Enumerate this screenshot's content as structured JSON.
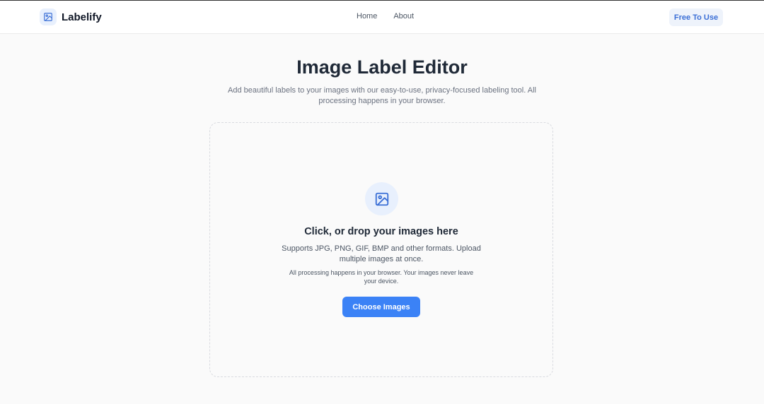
{
  "header": {
    "brand_name": "Labelify",
    "brand_icon": "image-icon",
    "nav": [
      {
        "label": "Home"
      },
      {
        "label": "About"
      }
    ],
    "badge_label": "Free To Use"
  },
  "hero": {
    "title": "Image Label Editor",
    "subtitle": "Add beautiful labels to your images with our easy-to-use, privacy-focused labeling tool. All processing happens in your browser."
  },
  "dropzone": {
    "icon": "image-icon",
    "title": "Click, or drop your images here",
    "description": "Supports JPG, PNG, GIF, BMP and other formats. Upload multiple images at once.",
    "note": "All processing happens in your browser. Your images never leave your device.",
    "button_label": "Choose Images"
  },
  "colors": {
    "accent": "#3b82f6",
    "icon_background": "#e8f0fd",
    "badge_text": "#3b6fd6",
    "page_background": "#fafafa"
  }
}
